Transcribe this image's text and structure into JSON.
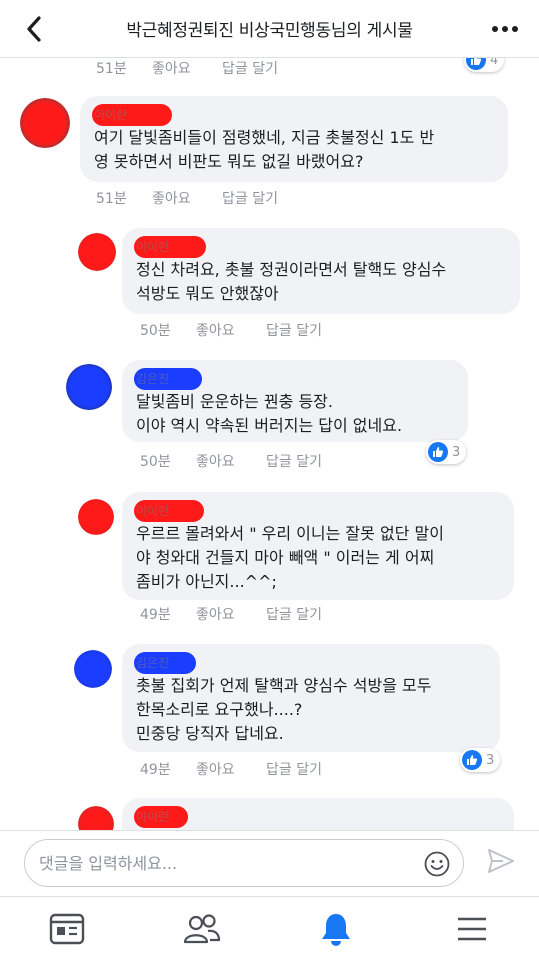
{
  "header": {
    "title": "박근혜정권퇴진 비상국민행동님의 게시물"
  },
  "top_actions": {
    "time": "51분",
    "like": "좋아요",
    "reply": "답글 달기",
    "reaction_count": "4"
  },
  "comments": [
    {
      "name": "이이란",
      "text": "여기 달빛좀비들이 점령했네, 지금 촛불정신 1도 반\n영 못하면서 비판도 뭐도 없길 바랬어요?",
      "time": "51분",
      "like": "좋아요",
      "reply": "답글 달기",
      "reaction": ""
    },
    {
      "name": "이이란",
      "text": "정신 차려요, 촛불 정권이라면서 탈핵도 양심수\n석방도 뭐도 안했잖아",
      "time": "50분",
      "like": "좋아요",
      "reply": "답글 달기",
      "reaction": ""
    },
    {
      "name": "김은진",
      "text": "달빛좀비 운운하는 꿘충 등장.\n이야 역시 약속된 버러지는 답이 없네요.",
      "time": "50분",
      "like": "좋아요",
      "reply": "답글 달기",
      "reaction": "3"
    },
    {
      "name": "이이란",
      "text": "우르르 몰려와서 \" 우리 이니는 잘못 없단 말이\n야 청와대 건들지 마아 빼액 \" 이러는 게 어찌\n좀비가 아닌지...^^;",
      "time": "49분",
      "like": "좋아요",
      "reply": "답글 달기",
      "reaction": ""
    },
    {
      "name": "김은진",
      "text": "촛불 집회가 언제 탈핵과 양심수 석방을 모두\n한목소리로 요구했나....?\n민중당 당직자 답네요.",
      "time": "49분",
      "like": "좋아요",
      "reply": "답글 달기",
      "reaction": "3"
    },
    {
      "name": "이이란",
      "text": "",
      "time": "",
      "like": "",
      "reply": "",
      "reaction": ""
    }
  ],
  "input": {
    "placeholder": "댓글을 입력하세요..."
  },
  "nav": {
    "items": [
      "feed-icon",
      "friends-icon",
      "notifications-icon",
      "menu-icon"
    ]
  },
  "colors": {
    "accent": "#1877f2",
    "redact_red": "#ff1a1a",
    "redact_blue": "#1a3dff"
  }
}
